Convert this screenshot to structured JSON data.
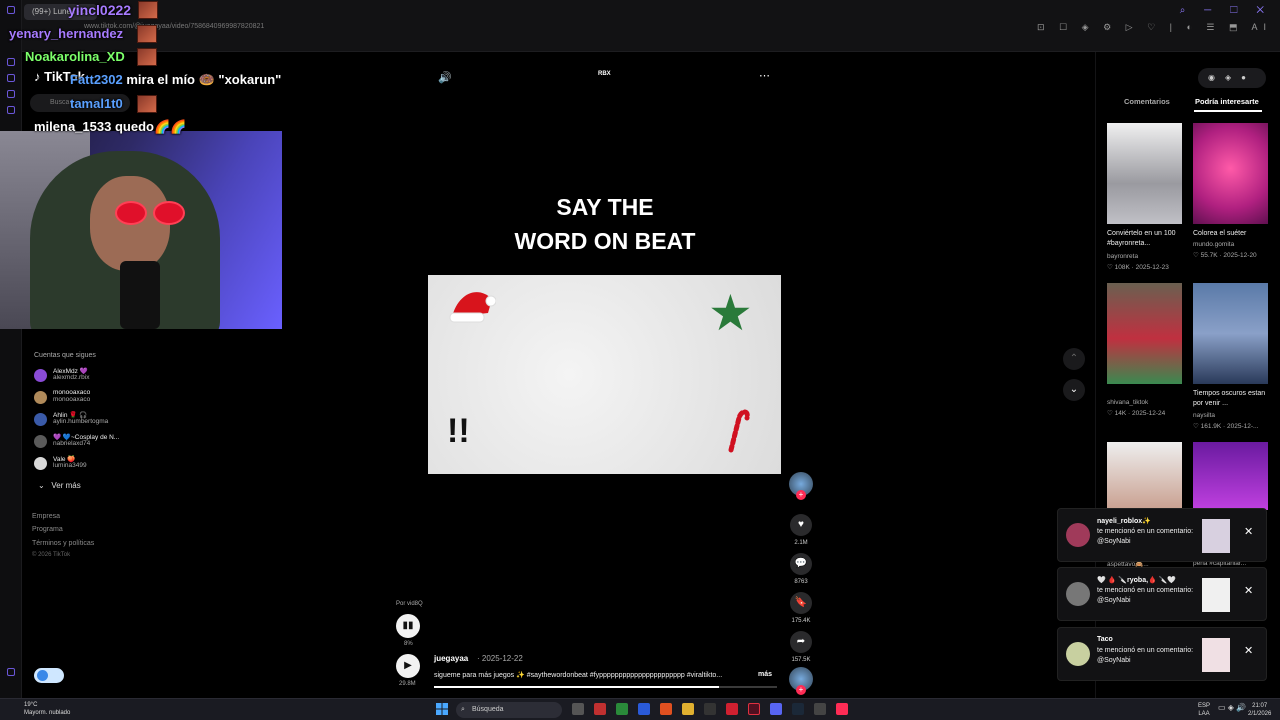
{
  "browser": {
    "tab_label": "(99+) Lunes - ...",
    "url": "www.tiktok.com/@juegayaa/video/7586840969987820821",
    "window_controls": "⌕ ─ ☐ ✕"
  },
  "tiktok_nav": {
    "logo": "TikTok",
    "search_placeholder": "Buscar",
    "following_title": "Cuentas que sigues",
    "following": [
      {
        "name": "AlexMdz 💜",
        "handle": "alexmdz.rbix",
        "color": "#8a4bd6"
      },
      {
        "name": "monooaxaco",
        "handle": "monooaxaco",
        "color": "#b08a5a"
      },
      {
        "name": "Ahlin 🌹 🎧",
        "handle": "aylin.humbertogma",
        "color": "#3a5aa8"
      },
      {
        "name": "💜 💙~Cosplay de N...",
        "handle": "nabrielaxd74",
        "color": "#5a5a5a"
      },
      {
        "name": "Vale 🍑",
        "handle": "lumina3499",
        "color": "#d8d8d8"
      }
    ],
    "see_more": "Ver más",
    "footer": [
      "Empresa",
      "Programa",
      "Términos y políticas"
    ],
    "copyright": "© 2026 TikTok"
  },
  "stream_chat": [
    {
      "user": "yincl0222",
      "text": "",
      "color": "#a77bff"
    },
    {
      "user": "yenary_hernandez",
      "text": "",
      "color": "#a77bff"
    },
    {
      "user": "Noakarolina_XD",
      "text": "",
      "color": "#7cff6a"
    },
    {
      "user": "Fatt2302",
      "text": "mira el mío 🍩 \"xokarun\"",
      "color": "#5aa0ff"
    },
    {
      "user": "tamal1t0",
      "text": "",
      "color": "#5aa0ff"
    },
    {
      "user": "milena_1533",
      "text": "quedo🌈🌈",
      "color": "#ffffff"
    }
  ],
  "video": {
    "title_line1": "SAY THE",
    "title_line2": "WORD ON BEAT",
    "top_badge": "RBX",
    "volume_icon": "🔊",
    "more_icon": "⋯",
    "author": "juegayaa",
    "date": "2025-12-22",
    "caption": "sigueme para más juegos ✨ #saythewordonbeat #fypppppppppppppppppppppp #viraltikto...",
    "more_label": "más",
    "progress_fraction": 0.83,
    "mini_label_top": "Por vid8Q",
    "mini_label_pct": "8%",
    "mini_label_time": "29.8M"
  },
  "actions": [
    {
      "icon": "♥",
      "count": "2.1M",
      "name": "like"
    },
    {
      "icon": "💬",
      "count": "8763",
      "name": "comment"
    },
    {
      "icon": "🔖",
      "count": "175.4K",
      "name": "save"
    },
    {
      "icon": "➦",
      "count": "157.5K",
      "name": "share"
    }
  ],
  "right_panel": {
    "tab_comments": "Comentarios",
    "tab_interest": "Podría interesarte",
    "videos": [
      {
        "title": "Conviértelo en un 100 #bayronreta...",
        "author": "bayronreta",
        "likes": "108K",
        "date": "2025-12-23"
      },
      {
        "title": "Colorea el suéter",
        "author": "mundo.gomita",
        "likes": "55.7K",
        "date": "2025-12-20"
      },
      {
        "title": "",
        "author": "shivana_tiktok",
        "likes": "14K",
        "date": "2025-12-24"
      },
      {
        "title": "Tiempos oscuros estan por venir ...",
        "author": "naysilta",
        "likes": "161.9K",
        "date": "2025-12-..."
      },
      {
        "title": "",
        "author": "aspettavo🙈...",
        "likes": "",
        "date": ""
      },
      {
        "title": "",
        "author": "pena #capitanlar...",
        "likes": "",
        "date": ""
      }
    ]
  },
  "notifications": [
    {
      "who": "nayeli_roblox✨",
      "msg": "te mencionó en un comentario: @SoyNabi",
      "color": "#a03a5a"
    },
    {
      "who": "🤍 🩸 🔪ryoba,🩸 🔪🤍",
      "msg": "te mencionó en un comentario: @SoyNabi",
      "color": "#777777"
    },
    {
      "who": "Taco",
      "msg": "te mencionó en un comentario: @SoyNabi",
      "color": "#c8d0a0"
    }
  ],
  "taskbar": {
    "weather_temp": "19°C",
    "weather_desc": "Mayorm. nublado",
    "search": "Búsqueda",
    "lang1": "ESP",
    "lang2": "LAA",
    "time": "21:07",
    "date": "2/1/2026"
  }
}
